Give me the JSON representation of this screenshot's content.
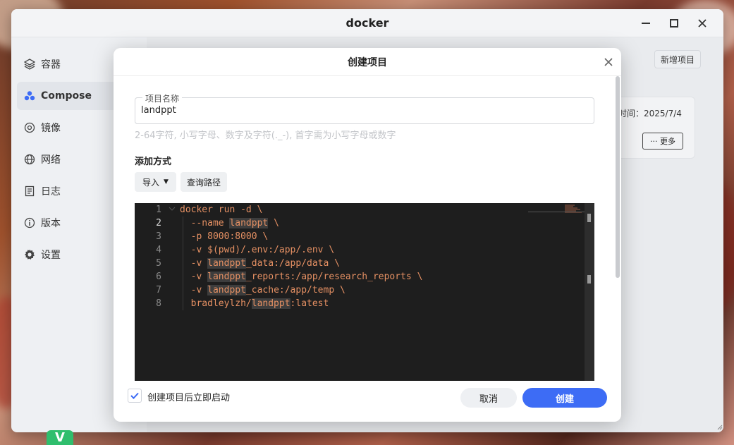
{
  "window": {
    "title": "docker"
  },
  "sidebar": {
    "items": [
      {
        "label": "容器",
        "icon": "layers-icon"
      },
      {
        "label": "Compose",
        "icon": "compose-icon",
        "active": true
      },
      {
        "label": "镜像",
        "icon": "disc-icon"
      },
      {
        "label": "网络",
        "icon": "globe-icon"
      },
      {
        "label": "日志",
        "icon": "log-icon"
      },
      {
        "label": "版本",
        "icon": "info-icon"
      },
      {
        "label": "设置",
        "icon": "gear-icon"
      }
    ]
  },
  "main": {
    "add_project_label": "新增项目",
    "card_time": "时间：2025/7/4",
    "more_label": "··· 更多"
  },
  "dialog": {
    "title": "创建项目",
    "name_legend": "项目名称",
    "name_value": "landppt",
    "name_hint": "2-64字符, 小写字母、数字及字符(._-), 首字需为小写字母或数字",
    "method_label": "添加方式",
    "import_label": "导入",
    "query_path_label": "查询路径",
    "editor": {
      "current_line": 2,
      "lines": [
        {
          "num": "1",
          "text": "docker run -d \\"
        },
        {
          "num": "2",
          "pre": "  --name ",
          "hl": "landppt",
          "post": " \\"
        },
        {
          "num": "3",
          "text": "  -p 8000:8000 \\"
        },
        {
          "num": "4",
          "text": "  -v $(pwd)/.env:/app/.env \\"
        },
        {
          "num": "5",
          "pre": "  -v ",
          "hl": "landppt",
          "post": "_data:/app/data \\"
        },
        {
          "num": "6",
          "pre": "  -v ",
          "hl": "landppt",
          "post": "_reports:/app/research_reports \\"
        },
        {
          "num": "7",
          "pre": "  -v ",
          "hl": "landppt",
          "post": "_cache:/app/temp \\"
        },
        {
          "num": "8",
          "pre": "  bradleylzh/",
          "hl": "landppt",
          "post": ":latest"
        }
      ]
    },
    "autostart_label": "创建项目后立即启动",
    "autostart_checked": true,
    "cancel_label": "取消",
    "create_label": "创建"
  },
  "colors": {
    "accent": "#3d6cf5",
    "code_text": "#e59063",
    "editor_bg": "#1e1e1e"
  }
}
